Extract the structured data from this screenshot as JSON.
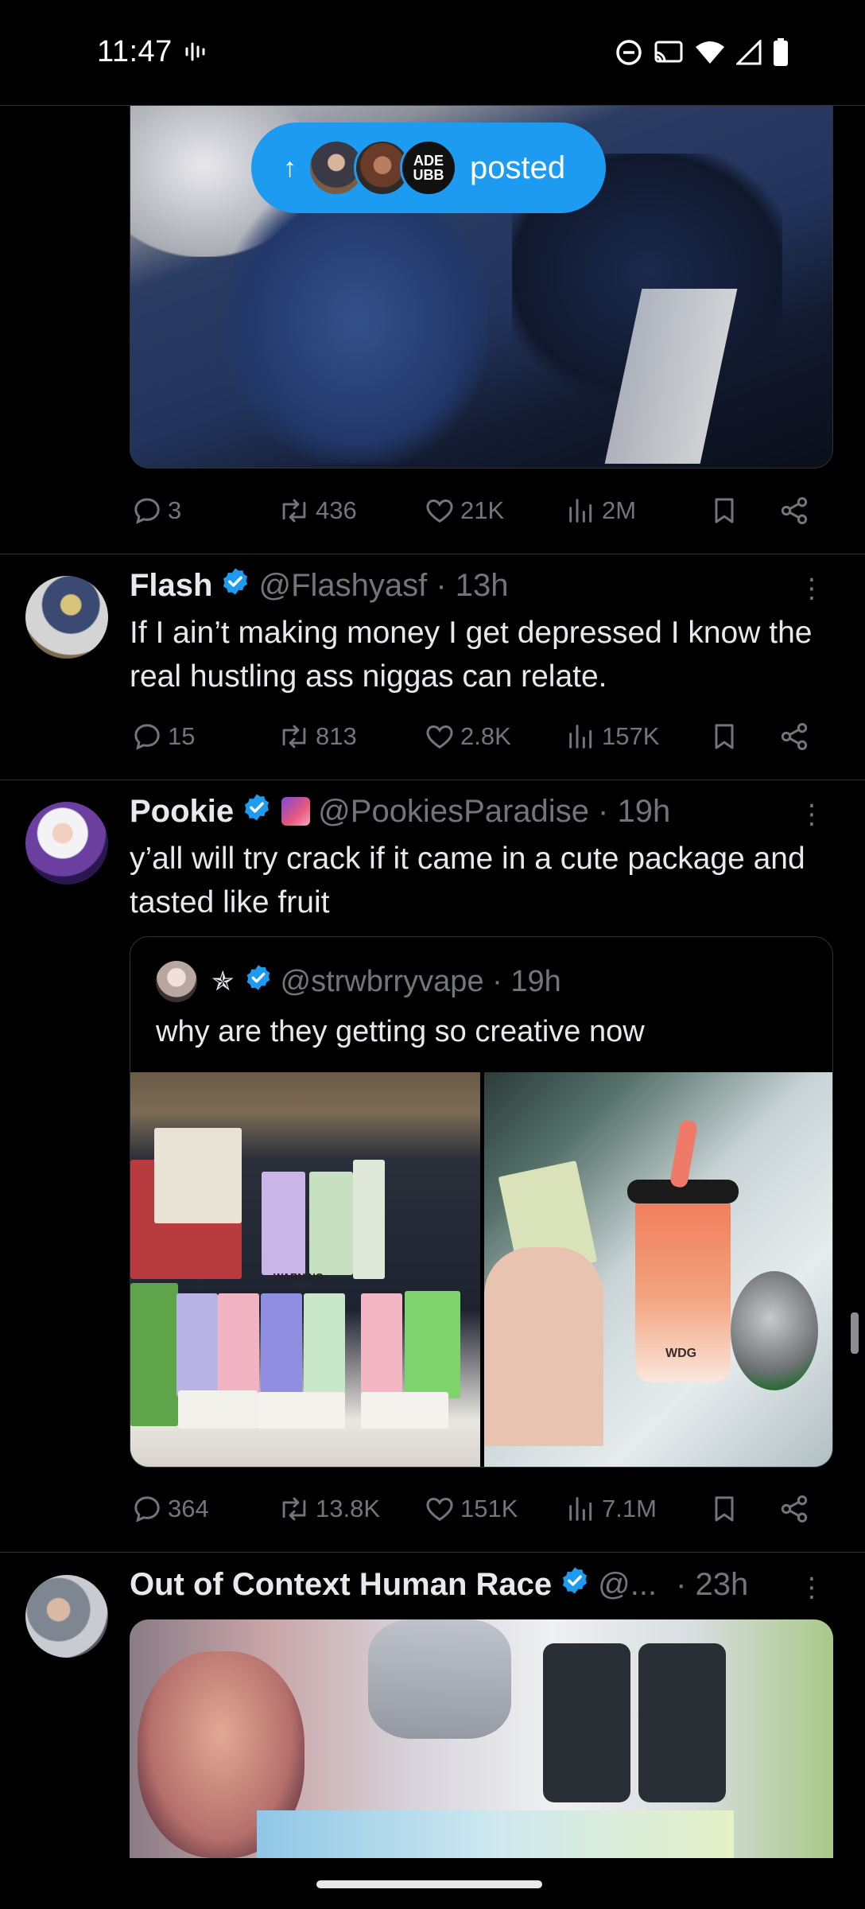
{
  "status_bar": {
    "time": "11:47",
    "icons": [
      "voice-activity-icon",
      "do-not-disturb-icon",
      "cast-icon",
      "wifi-icon",
      "signal-icon",
      "battery-icon"
    ]
  },
  "new_posts_pill": {
    "arrow": "↑",
    "label": "posted",
    "avatar_badge_text": "ADE\nUBB"
  },
  "tweets": [
    {
      "id": "tweet-1",
      "stats": {
        "replies": "3",
        "reposts": "436",
        "likes": "21K",
        "views": "2M"
      }
    },
    {
      "id": "tweet-flash",
      "name": "Flash",
      "verified": true,
      "handle": "@Flashyasf · 13h",
      "text": "If I ain’t making money I get depressed I know the real hustling ass niggas can relate.",
      "stats": {
        "replies": "15",
        "reposts": "813",
        "likes": "2.8K",
        "views": "157K"
      }
    },
    {
      "id": "tweet-pookie",
      "name": "Pookie",
      "verified": true,
      "handle": "@PookiesParadise · 19h",
      "text": "y’all will try crack if it came in a cute package and tasted like fruit",
      "quote": {
        "star": "✯",
        "handle": "@strwbrryvape · 19h",
        "text": "why are they getting so creative now",
        "left_image_text": "WARNING:",
        "right_image_text": "WDG"
      },
      "stats": {
        "replies": "364",
        "reposts": "13.8K",
        "likes": "151K",
        "views": "7.1M"
      }
    },
    {
      "id": "tweet-ooc",
      "name": "Out of Context Human Race",
      "verified": true,
      "handle": "@...",
      "time": "· 23h"
    }
  ],
  "colors": {
    "accent": "#1d9bf0",
    "muted": "#71767b",
    "text": "#e7e9ea",
    "background": "#000000",
    "divider": "#2f3336"
  }
}
